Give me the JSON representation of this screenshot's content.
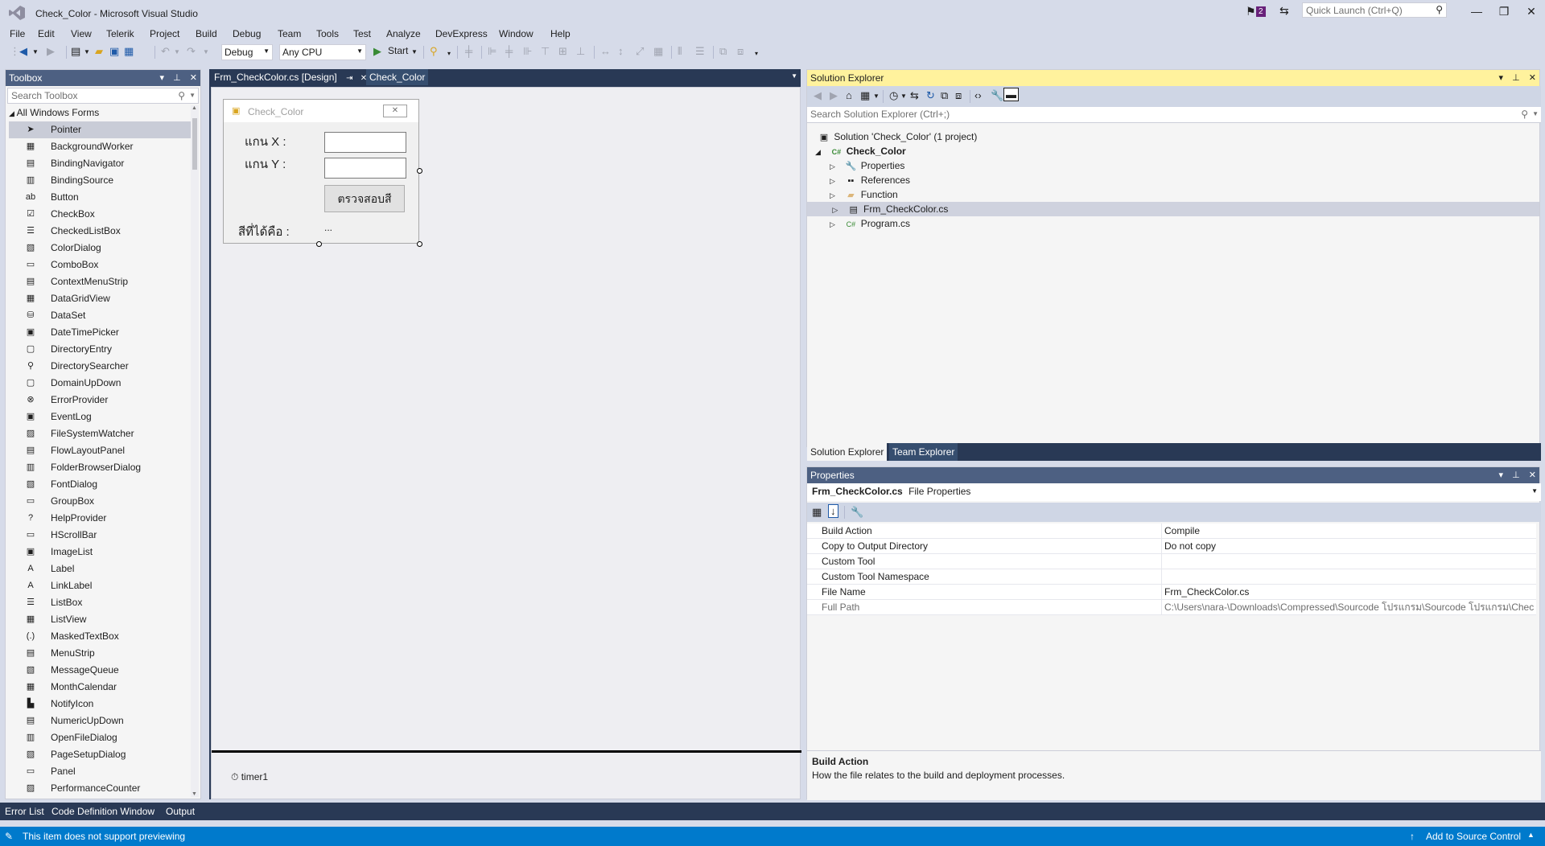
{
  "window": {
    "title": "Check_Color - Microsoft Visual Studio",
    "notification_count": "2",
    "quick_launch_placeholder": "Quick Launch (Ctrl+Q)",
    "minimize": "—",
    "maximize": "❐",
    "close": "✕"
  },
  "menu": [
    "File",
    "Edit",
    "View",
    "Telerik",
    "Project",
    "Build",
    "Debug",
    "Team",
    "Tools",
    "Test",
    "Analyze",
    "DevExpress",
    "Window",
    "Help"
  ],
  "toolbar": {
    "config": "Debug",
    "platform": "Any CPU",
    "start_label": "Start"
  },
  "toolbox": {
    "title": "Toolbox",
    "search_placeholder": "Search Toolbox",
    "group": "All Windows Forms",
    "items": [
      {
        "icon": "pointer-icon",
        "glyph": "➤",
        "label": "Pointer"
      },
      {
        "icon": "backgroundworker-icon",
        "glyph": "▦",
        "label": "BackgroundWorker"
      },
      {
        "icon": "bindingnavigator-icon",
        "glyph": "▤",
        "label": "BindingNavigator"
      },
      {
        "icon": "bindingsource-icon",
        "glyph": "▥",
        "label": "BindingSource"
      },
      {
        "icon": "button-icon",
        "glyph": "ab",
        "label": "Button"
      },
      {
        "icon": "checkbox-icon",
        "glyph": "☑",
        "label": "CheckBox"
      },
      {
        "icon": "checkedlistbox-icon",
        "glyph": "☰",
        "label": "CheckedListBox"
      },
      {
        "icon": "colordialog-icon",
        "glyph": "▧",
        "label": "ColorDialog"
      },
      {
        "icon": "combobox-icon",
        "glyph": "▭",
        "label": "ComboBox"
      },
      {
        "icon": "contextmenustrip-icon",
        "glyph": "▤",
        "label": "ContextMenuStrip"
      },
      {
        "icon": "datagridview-icon",
        "glyph": "▦",
        "label": "DataGridView"
      },
      {
        "icon": "dataset-icon",
        "glyph": "⛁",
        "label": "DataSet"
      },
      {
        "icon": "datetimepicker-icon",
        "glyph": "▣",
        "label": "DateTimePicker"
      },
      {
        "icon": "directoryentry-icon",
        "glyph": "▢",
        "label": "DirectoryEntry"
      },
      {
        "icon": "directorysearcher-icon",
        "glyph": "⚲",
        "label": "DirectorySearcher"
      },
      {
        "icon": "domainupdown-icon",
        "glyph": "▢",
        "label": "DomainUpDown"
      },
      {
        "icon": "errorprovider-icon",
        "glyph": "⊗",
        "label": "ErrorProvider"
      },
      {
        "icon": "eventlog-icon",
        "glyph": "▣",
        "label": "EventLog"
      },
      {
        "icon": "filesystemwatcher-icon",
        "glyph": "▨",
        "label": "FileSystemWatcher"
      },
      {
        "icon": "flowlayoutpanel-icon",
        "glyph": "▤",
        "label": "FlowLayoutPanel"
      },
      {
        "icon": "folderbrowserdialog-icon",
        "glyph": "▥",
        "label": "FolderBrowserDialog"
      },
      {
        "icon": "fontdialog-icon",
        "glyph": "▧",
        "label": "FontDialog"
      },
      {
        "icon": "groupbox-icon",
        "glyph": "▭",
        "label": "GroupBox"
      },
      {
        "icon": "helpprovider-icon",
        "glyph": "?",
        "label": "HelpProvider"
      },
      {
        "icon": "hscrollbar-icon",
        "glyph": "▭",
        "label": "HScrollBar"
      },
      {
        "icon": "imagelist-icon",
        "glyph": "▣",
        "label": "ImageList"
      },
      {
        "icon": "label-icon",
        "glyph": "A",
        "label": "Label"
      },
      {
        "icon": "linklabel-icon",
        "glyph": "A",
        "label": "LinkLabel"
      },
      {
        "icon": "listbox-icon",
        "glyph": "☰",
        "label": "ListBox"
      },
      {
        "icon": "listview-icon",
        "glyph": "▦",
        "label": "ListView"
      },
      {
        "icon": "maskedtextbox-icon",
        "glyph": "(.)",
        "label": "MaskedTextBox"
      },
      {
        "icon": "menustrip-icon",
        "glyph": "▤",
        "label": "MenuStrip"
      },
      {
        "icon": "messagequeue-icon",
        "glyph": "▧",
        "label": "MessageQueue"
      },
      {
        "icon": "monthcalendar-icon",
        "glyph": "▦",
        "label": "MonthCalendar"
      },
      {
        "icon": "notifyicon-icon",
        "glyph": "▙",
        "label": "NotifyIcon"
      },
      {
        "icon": "numericupdown-icon",
        "glyph": "▤",
        "label": "NumericUpDown"
      },
      {
        "icon": "openfiledialog-icon",
        "glyph": "▥",
        "label": "OpenFileDialog"
      },
      {
        "icon": "pagesetupdialog-icon",
        "glyph": "▧",
        "label": "PageSetupDialog"
      },
      {
        "icon": "panel-icon",
        "glyph": "▭",
        "label": "Panel"
      },
      {
        "icon": "performancecounter-icon",
        "glyph": "▨",
        "label": "PerformanceCounter"
      }
    ]
  },
  "document": {
    "tabs": [
      {
        "label": "Frm_CheckColor.cs [Design]",
        "pin": "⇥",
        "close": "✕"
      },
      {
        "label": "Check_Color"
      }
    ],
    "form": {
      "title": "Check_Color",
      "label_x": "แกน X :",
      "label_y": "แกน Y :",
      "button": "ตรวจสอบสี",
      "result_label": "สีที่ได้คือ :",
      "result_value": "..."
    },
    "tray_component": "timer1"
  },
  "solution_explorer": {
    "title": "Solution Explorer",
    "search_placeholder": "Search Solution Explorer (Ctrl+;)",
    "solution": "Solution 'Check_Color' (1 project)",
    "project": "Check_Color",
    "nodes": [
      "Properties",
      "References",
      "Function",
      "Frm_CheckColor.cs",
      "Program.cs"
    ],
    "tabs": [
      "Solution Explorer",
      "Team Explorer"
    ]
  },
  "properties": {
    "title": "Properties",
    "object_name": "Frm_CheckColor.cs",
    "object_type": "File Properties",
    "rows": [
      {
        "name": "Build Action",
        "value": "Compile"
      },
      {
        "name": "Copy to Output Directory",
        "value": "Do not copy"
      },
      {
        "name": "Custom Tool",
        "value": ""
      },
      {
        "name": "Custom Tool Namespace",
        "value": ""
      },
      {
        "name": "File Name",
        "value": "Frm_CheckColor.cs"
      },
      {
        "name": "Full Path",
        "value": "C:\\Users\\nara-\\Downloads\\Compressed\\Sourcode โปรแกรม\\Sourcode โปรแกรม\\Check_"
      }
    ],
    "desc_title": "Build Action",
    "desc_text": "How the file relates to the build and deployment processes."
  },
  "bottom_tabs": [
    "Error List",
    "Code Definition Window",
    "Output"
  ],
  "status": {
    "message": "This item does not support previewing",
    "source_control": "Add to Source Control"
  }
}
